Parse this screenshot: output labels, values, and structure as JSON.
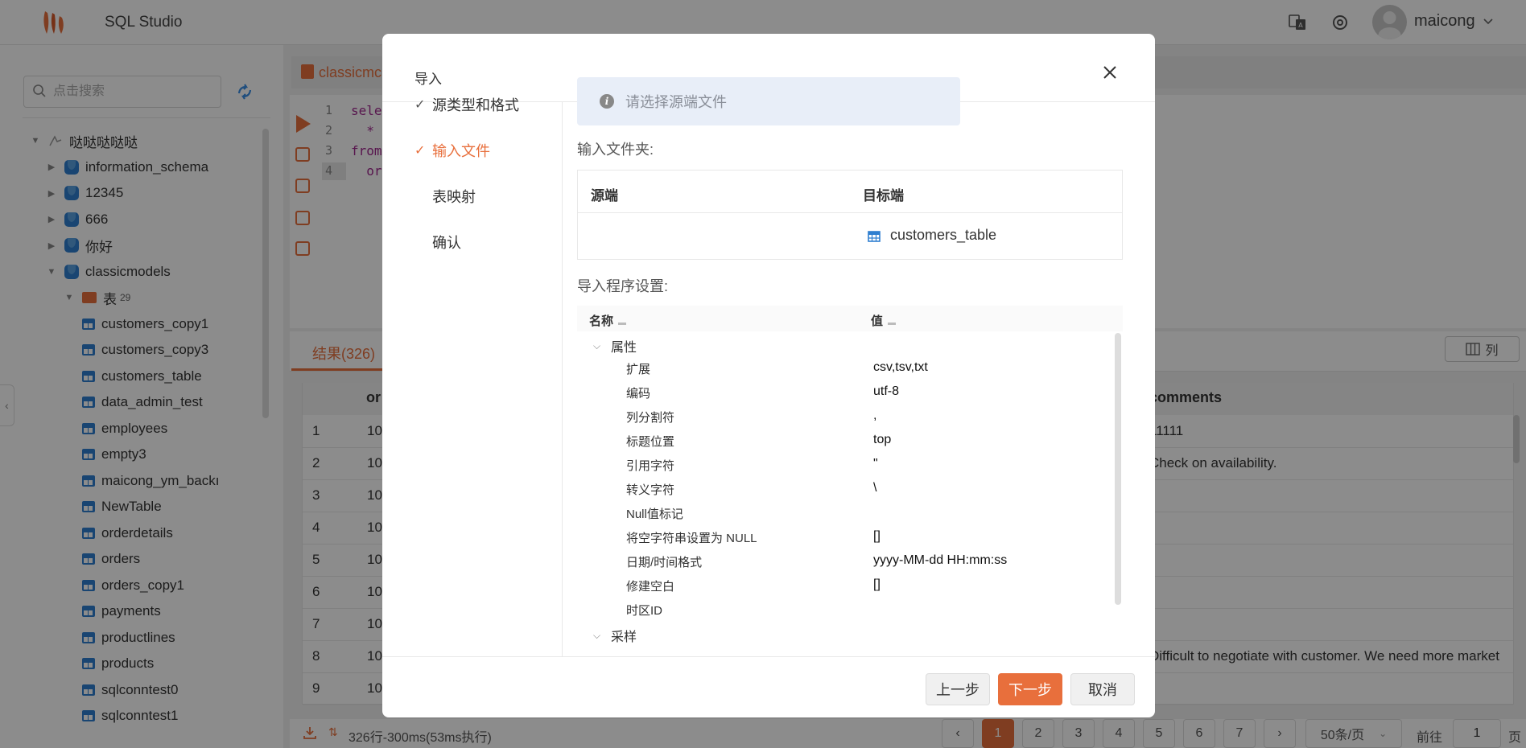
{
  "header": {
    "app_title": "SQL Studio",
    "username": "maicong",
    "logo_icon": "brand-logo",
    "translate_icon": "translate-icon",
    "settings_icon": "gear-icon"
  },
  "sidebar": {
    "search_placeholder": "点击搜索",
    "tree": [
      {
        "label": "哒哒哒哒哒",
        "type": "connection",
        "expanded": true
      },
      {
        "label": "information_schema",
        "type": "database"
      },
      {
        "label": "12345",
        "type": "database"
      },
      {
        "label": "666",
        "type": "database"
      },
      {
        "label": "你好",
        "type": "database"
      },
      {
        "label": "classicmodels",
        "type": "database",
        "expanded": true
      },
      {
        "label": "表",
        "badge": "29",
        "type": "folder",
        "expanded": true
      },
      {
        "label": "customers_copy1",
        "type": "table"
      },
      {
        "label": "customers_copy3",
        "type": "table"
      },
      {
        "label": "customers_table",
        "type": "table"
      },
      {
        "label": "data_admin_test",
        "type": "table"
      },
      {
        "label": "employees",
        "type": "table"
      },
      {
        "label": "empty3",
        "type": "table"
      },
      {
        "label": "maicong_ym_backı",
        "type": "table"
      },
      {
        "label": "NewTable",
        "type": "table"
      },
      {
        "label": "orderdetails",
        "type": "table"
      },
      {
        "label": "orders",
        "type": "table"
      },
      {
        "label": "orders_copy1",
        "type": "table"
      },
      {
        "label": "payments",
        "type": "table"
      },
      {
        "label": "productlines",
        "type": "table"
      },
      {
        "label": "products",
        "type": "table"
      },
      {
        "label": "sqlconntest0",
        "type": "table"
      },
      {
        "label": "sqlconntest1",
        "type": "table"
      }
    ]
  },
  "editor": {
    "tab_label": "classicmc",
    "lines": [
      {
        "num": "1",
        "code": "sele"
      },
      {
        "num": "2",
        "code": "  *"
      },
      {
        "num": "3",
        "code": "from"
      },
      {
        "num": "4",
        "code": "  or"
      }
    ]
  },
  "results": {
    "tab_label": "结果(326)",
    "columns_button": "列",
    "col_or": "or",
    "col_comments": "comments",
    "rows": [
      {
        "n": "1",
        "c1": "10",
        "comments": "11111"
      },
      {
        "n": "2",
        "c1": "10",
        "comments": "Check on availability."
      },
      {
        "n": "3",
        "c1": "10",
        "comments": ""
      },
      {
        "n": "4",
        "c1": "10",
        "comments": ""
      },
      {
        "n": "5",
        "c1": "10",
        "comments": ""
      },
      {
        "n": "6",
        "c1": "10",
        "comments": ""
      },
      {
        "n": "7",
        "c1": "10",
        "comments": ""
      },
      {
        "n": "8",
        "c1": "10",
        "comments": "Difficult to negotiate with customer. We need more market"
      },
      {
        "n": "9",
        "c1": "10",
        "comments": ""
      }
    ],
    "status_text": "326行-300ms(53ms执行)",
    "pages": [
      "1",
      "2",
      "3",
      "4",
      "5",
      "6",
      "7"
    ],
    "current_page": "1",
    "page_size": "50条/页",
    "goto_label": "前往",
    "goto_value": "1",
    "goto_suffix": "页"
  },
  "modal": {
    "title": "导入",
    "steps": [
      {
        "label": "源类型和格式",
        "done": true
      },
      {
        "label": "输入文件",
        "done": true,
        "current": true
      },
      {
        "label": "表映射"
      },
      {
        "label": "确认"
      }
    ],
    "alert_text": "请选择源端文件",
    "input_folder_label": "输入文件夹:",
    "mapping_headers": {
      "source": "源端",
      "target": "目标端"
    },
    "mapping_row": {
      "source": "",
      "target": "customers_table"
    },
    "settings_label": "导入程序设置:",
    "settings_headers": {
      "name": "名称",
      "value": "值"
    },
    "settings_groups": [
      {
        "category": "属性",
        "rows": [
          {
            "name": "扩展",
            "value": "csv,tsv,txt"
          },
          {
            "name": "编码",
            "value": "utf-8"
          },
          {
            "name": "列分割符",
            "value": ","
          },
          {
            "name": "标题位置",
            "value": "top"
          },
          {
            "name": "引用字符",
            "value": "\""
          },
          {
            "name": "转义字符",
            "value": "\\"
          },
          {
            "name": "Null值标记",
            "value": ""
          },
          {
            "name": "将空字符串设置为 NULL",
            "value": "[]"
          },
          {
            "name": "日期/时间格式",
            "value": "yyyy-MM-dd HH:mm:ss"
          },
          {
            "name": "修建空白",
            "value": "[]"
          },
          {
            "name": "时区ID",
            "value": ""
          }
        ]
      },
      {
        "category": "采样",
        "rows": []
      }
    ],
    "buttons": {
      "prev": "上一步",
      "next": "下一步",
      "cancel": "取消"
    }
  },
  "colors": {
    "accent": "#e86f3c",
    "table_icon": "#2f7fd0",
    "alert_bg": "#e8eef8"
  }
}
